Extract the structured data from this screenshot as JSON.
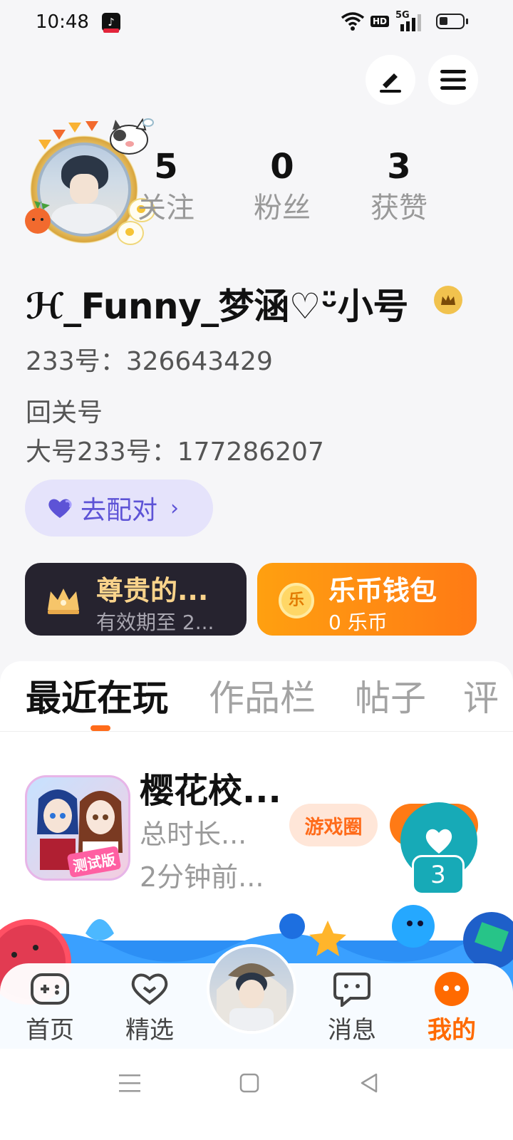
{
  "status_bar": {
    "time": "10:48",
    "app_badge_icon": "tiktok-icon",
    "hd_label": "HD",
    "network_label": "5G",
    "icons": [
      "wifi-icon",
      "signal-icon",
      "battery-icon"
    ]
  },
  "header_actions": {
    "edit_icon": "pencil-icon",
    "menu_icon": "hamburger-menu-icon"
  },
  "profile": {
    "stats": [
      {
        "value": "5",
        "label": "关注"
      },
      {
        "value": "0",
        "label": "粉丝"
      },
      {
        "value": "3",
        "label": "获赞"
      }
    ],
    "username": "ℋ_Funny_梦涵♡ᵕ̈小号",
    "id_line": "233号：326643429",
    "bio_line1": "回关号",
    "bio_line2": "大号233号：177286207",
    "pair_button": {
      "label": "去配对",
      "icon": "heart-icon",
      "chevron": "›"
    }
  },
  "cards": {
    "vip": {
      "title": "尊贵的...",
      "subtitle": "有效期至 2...",
      "icon": "crown-icon"
    },
    "wallet": {
      "title": "乐币钱包",
      "subtitle": "0 乐币",
      "icon": "coin-icon",
      "coin_glyph": "乐"
    }
  },
  "tabs": [
    {
      "label": "最近在玩",
      "active": true
    },
    {
      "label": "作品栏",
      "active": false
    },
    {
      "label": "帖子",
      "active": false
    },
    {
      "label": "评",
      "active": false
    }
  ],
  "recent_game": {
    "title": "樱花校...",
    "playtime": "总时长...",
    "last_played": "2分钟前...",
    "icon_tag": "测试版",
    "circle_button": "游戏圈",
    "like_count": "3"
  },
  "bottom_nav": [
    {
      "label": "首页",
      "icon": "gamepad-icon",
      "active": false
    },
    {
      "label": "精选",
      "icon": "heart-chat-icon",
      "active": false
    },
    {
      "label": "消息",
      "icon": "chat-icon",
      "active": false
    },
    {
      "label": "我的",
      "icon": "profile-dots-icon",
      "active": true
    }
  ],
  "colors": {
    "accent": "#ff6b1a",
    "pair_purple": "#5d53d6",
    "teal": "#17aab7",
    "vip_gold": "#f9d38b"
  }
}
